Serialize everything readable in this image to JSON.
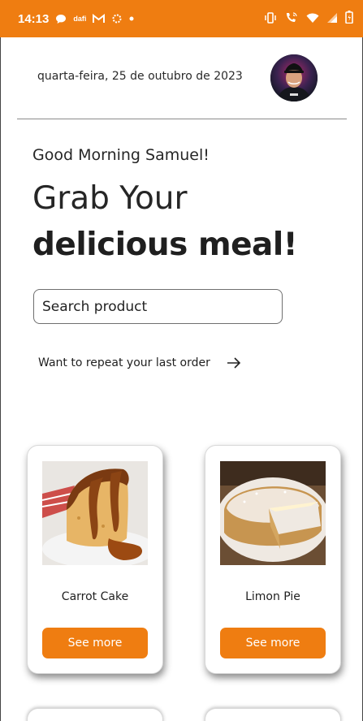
{
  "status_bar": {
    "time": "14:13",
    "background": "#ef7d11",
    "left_icons": [
      "chat-bubble-icon",
      "daily-app-icon",
      "gmail-icon",
      "settings-gear-icon",
      "dot-icon"
    ],
    "right_icons": [
      "vibrate-icon",
      "wifi-calling-icon",
      "wifi-icon",
      "signal-icon",
      "battery-icon"
    ],
    "left_icon_label": "dafi"
  },
  "header": {
    "date": "quarta-feira, 25 de outubro de 2023",
    "avatar": "profile-photo"
  },
  "greeting": "Good Morning Samuel!",
  "headline": {
    "line1": "Grab Your",
    "line2": "delicious meal!"
  },
  "search": {
    "placeholder": "Search product",
    "value": ""
  },
  "repeat_order": {
    "label": "Want to repeat your last order",
    "icon": "arrow-right-icon"
  },
  "accent_color": "#ef7d11",
  "products": [
    {
      "name": "Carrot Cake",
      "button_label": "See more",
      "image": "carrot-cake-photo"
    },
    {
      "name": "Limon Pie",
      "button_label": "See more",
      "image": "lemon-pie-photo"
    }
  ]
}
